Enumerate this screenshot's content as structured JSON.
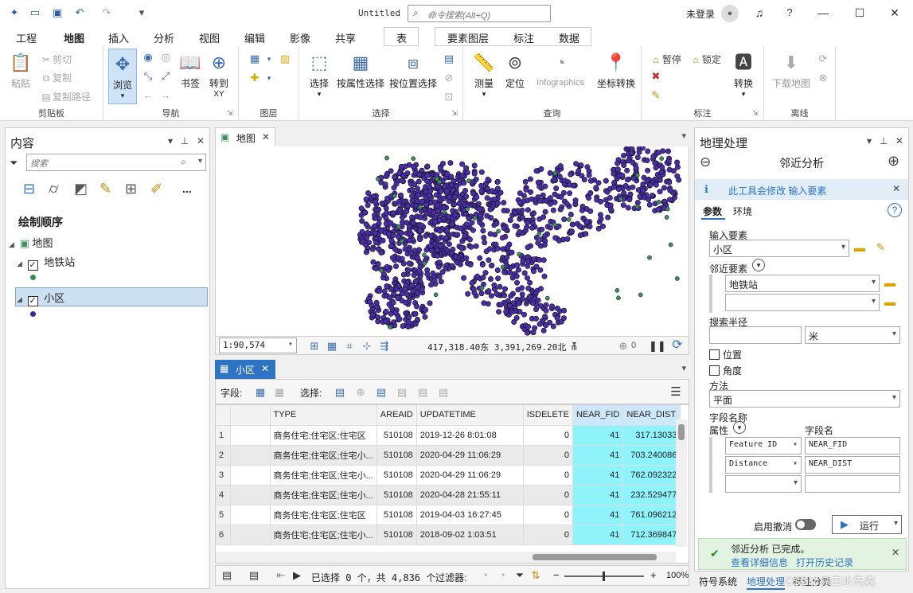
{
  "titlebar": {
    "doc_title": "Untitled",
    "search_placeholder": "命令搜索(Alt+Q)",
    "login": "未登录",
    "help": "?"
  },
  "tabs": [
    "工程",
    "地图",
    "插入",
    "分析",
    "视图",
    "编辑",
    "影像",
    "共享",
    "表",
    "要素图层",
    "标注",
    "数据"
  ],
  "ribbon": {
    "clipboard": {
      "label": "剪贴板",
      "paste": "粘贴",
      "cut": "剪切",
      "copy": "复制",
      "copy_path": "复制路径"
    },
    "navigate": {
      "label": "导航",
      "explore": "浏览",
      "bookmark": "书签",
      "goto": "转到",
      "goto_sub": "XY"
    },
    "layer": {
      "label": "图层"
    },
    "selection": {
      "label": "选择",
      "select": "选择",
      "by_attr": "按属性选择",
      "by_loc": "按位置选择"
    },
    "inquiry": {
      "label": "查询",
      "measure": "测量",
      "locate": "定位",
      "infographics": "Infographics",
      "convert_coords": "坐标转换"
    },
    "labeling": {
      "label": "标注",
      "pause": "暂停",
      "lock": "锁定",
      "convert": "转换"
    },
    "offline": {
      "label": "离线",
      "download": "下载地图"
    }
  },
  "contents": {
    "title": "内容",
    "search_placeholder": "搜索",
    "more": "...",
    "drawing_order": "绘制顺序",
    "map_name": "地图",
    "layers": [
      {
        "name": "地铁站",
        "symbol_color": "#2f8f4e"
      },
      {
        "name": "小区",
        "symbol_color": "#3a2a8f"
      }
    ]
  },
  "map": {
    "tab_label": "地图",
    "scale": "1:90,574",
    "coords": "417,318.40东 3,391,269.20北 m",
    "selected_count": "0",
    "point_color": "#4a2ea8",
    "station_color": "#3a8f5a"
  },
  "table": {
    "tab_label": "小区",
    "fields_label": "字段:",
    "select_label": "选择:",
    "columns": [
      "TYPE",
      "AREAID",
      "UPDATETIME",
      "ISDELETE",
      "NEAR_FID",
      "NEAR_DIST"
    ],
    "rows": [
      {
        "no": "1",
        "type": "商务住宅;住宅区;住宅区",
        "areaid": "510108",
        "time": "2019-12-26 8:01:08",
        "isdel": "0",
        "fid": "41",
        "dist": "317.13033"
      },
      {
        "no": "2",
        "type": "商务住宅;住宅区;住宅小...",
        "areaid": "510108",
        "time": "2020-04-29 11:06:29",
        "isdel": "0",
        "fid": "41",
        "dist": "703.240086"
      },
      {
        "no": "3",
        "type": "商务住宅;住宅区;住宅小...",
        "areaid": "510108",
        "time": "2020-04-29 11:06:29",
        "isdel": "0",
        "fid": "41",
        "dist": "762.092322"
      },
      {
        "no": "4",
        "type": "商务住宅;住宅区;住宅小...",
        "areaid": "510108",
        "time": "2020-04-28 21:55:11",
        "isdel": "0",
        "fid": "41",
        "dist": "232.529477"
      },
      {
        "no": "5",
        "type": "商务住宅;住宅区;住宅区",
        "areaid": "510108",
        "time": "2019-04-03 16:27:45",
        "isdel": "0",
        "fid": "41",
        "dist": "761.096212"
      },
      {
        "no": "6",
        "type": "商务住宅;住宅区;住宅小...",
        "areaid": "510108",
        "time": "2018-09-02 1:03:51",
        "isdel": "0",
        "fid": "41",
        "dist": "712.369847"
      }
    ],
    "status": "已选择 0 个，共 4,836 个",
    "filter_label": "过滤器:",
    "zoom": "100%"
  },
  "gp": {
    "title": "地理处理",
    "tool_name": "邻近分析",
    "info": "此工具会修改 输入要素",
    "tab_params": "参数",
    "tab_env": "环境",
    "input_label": "输入要素",
    "input_value": "小区",
    "near_label": "邻近要素",
    "near_value": "地铁站",
    "radius_label": "搜索半径",
    "radius_unit": "米",
    "location_label": "位置",
    "angle_label": "角度",
    "method_label": "方法",
    "method_value": "平面",
    "fieldnames_label": "字段名称",
    "attr_label": "属性",
    "fieldname_label": "字段名",
    "map_rows": [
      {
        "attr": "Feature ID",
        "name": "NEAR_FID"
      },
      {
        "attr": "Distance",
        "name": "NEAR_DIST"
      }
    ],
    "undo_label": "启用撤消",
    "run_label": "运行",
    "done_title": "邻近分析 已完成。",
    "done_details": "查看详细信息",
    "done_history": "打开历史记录",
    "bottom_tabs": [
      "符号系统",
      "地理处理",
      "标注分类"
    ],
    "watermark": "CSDN @白水先森"
  }
}
